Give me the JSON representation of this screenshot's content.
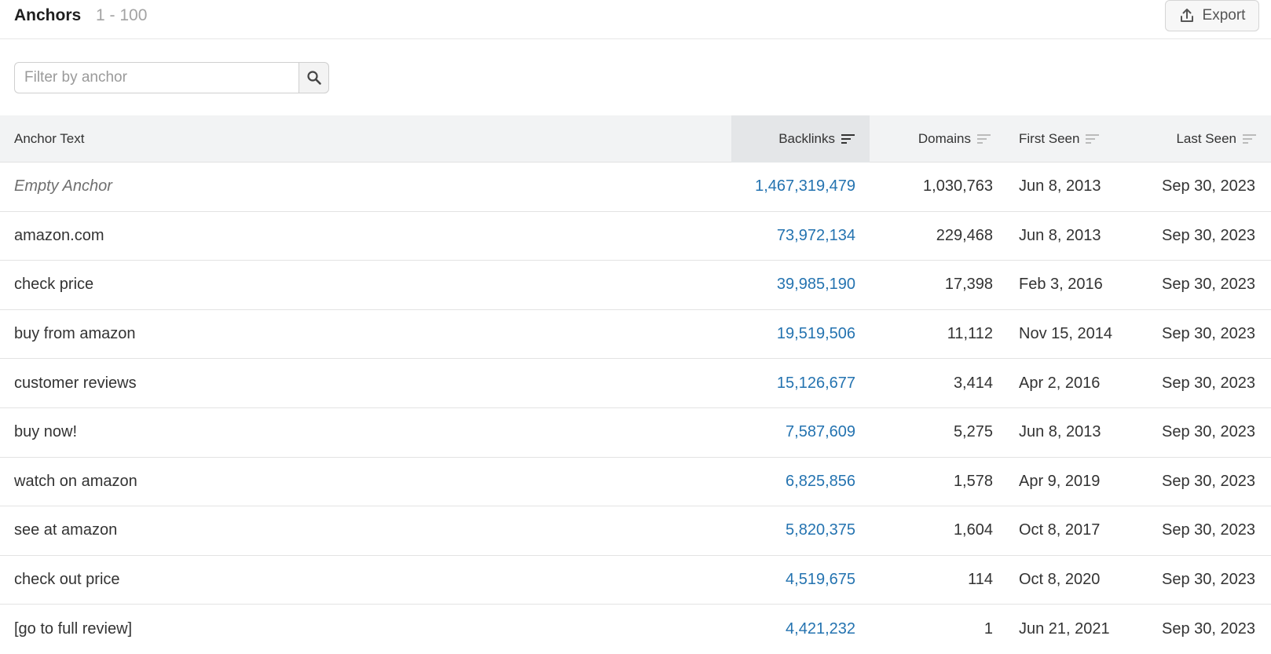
{
  "header": {
    "title": "Anchors",
    "range": "1 - 100",
    "export_label": "Export"
  },
  "filter": {
    "placeholder": "Filter by anchor",
    "value": ""
  },
  "icons": {
    "export": "upload-icon",
    "search": "search-icon",
    "sort": "sort-lines-icon"
  },
  "colors": {
    "link": "#2473b0",
    "header_bg": "#f2f3f4",
    "active_header_bg": "#e4e6e8"
  },
  "table": {
    "columns": {
      "anchor": "Anchor Text",
      "backlinks": "Backlinks",
      "domains": "Domains",
      "first_seen": "First Seen",
      "last_seen": "Last Seen"
    },
    "active_sort": "backlinks",
    "rows": [
      {
        "anchor": "Empty Anchor",
        "backlinks": "1,467,319,479",
        "domains": "1,030,763",
        "first_seen": "Jun 8, 2013",
        "last_seen": "Sep 30, 2023"
      },
      {
        "anchor": "amazon.com",
        "backlinks": "73,972,134",
        "domains": "229,468",
        "first_seen": "Jun 8, 2013",
        "last_seen": "Sep 30, 2023"
      },
      {
        "anchor": "check price",
        "backlinks": "39,985,190",
        "domains": "17,398",
        "first_seen": "Feb 3, 2016",
        "last_seen": "Sep 30, 2023"
      },
      {
        "anchor": "buy from amazon",
        "backlinks": "19,519,506",
        "domains": "11,112",
        "first_seen": "Nov 15, 2014",
        "last_seen": "Sep 30, 2023"
      },
      {
        "anchor": "customer reviews",
        "backlinks": "15,126,677",
        "domains": "3,414",
        "first_seen": "Apr 2, 2016",
        "last_seen": "Sep 30, 2023"
      },
      {
        "anchor": "buy now!",
        "backlinks": "7,587,609",
        "domains": "5,275",
        "first_seen": "Jun 8, 2013",
        "last_seen": "Sep 30, 2023"
      },
      {
        "anchor": "watch on amazon",
        "backlinks": "6,825,856",
        "domains": "1,578",
        "first_seen": "Apr 9, 2019",
        "last_seen": "Sep 30, 2023"
      },
      {
        "anchor": "see at amazon",
        "backlinks": "5,820,375",
        "domains": "1,604",
        "first_seen": "Oct 8, 2017",
        "last_seen": "Sep 30, 2023"
      },
      {
        "anchor": "check out price",
        "backlinks": "4,519,675",
        "domains": "114",
        "first_seen": "Oct 8, 2020",
        "last_seen": "Sep 30, 2023"
      },
      {
        "anchor": "[go to full review]",
        "backlinks": "4,421,232",
        "domains": "1",
        "first_seen": "Jun 21, 2021",
        "last_seen": "Sep 30, 2023"
      }
    ]
  }
}
